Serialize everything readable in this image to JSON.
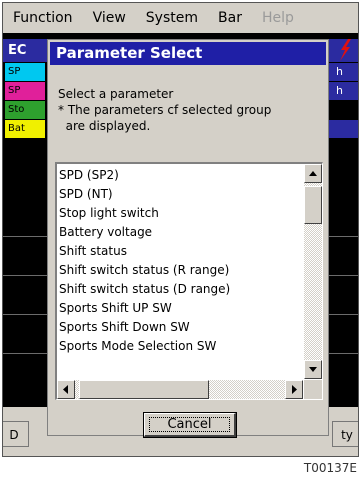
{
  "menu": [
    "Function",
    "View",
    "System",
    "Bar",
    "Help"
  ],
  "background": {
    "header_text": "EC",
    "side_rows": [
      "SP",
      "SP",
      "Sto",
      "Bat"
    ],
    "right_rows": [
      "h",
      "h"
    ],
    "bottom_left": "D",
    "bottom_right": "ty"
  },
  "dialog": {
    "title": "Parameter Select",
    "message_line1": "Select a parameter",
    "message_line2": "* The parameters cf selected group",
    "message_line3": "  are displayed.",
    "items": [
      "SPD (SP2)",
      "SPD (NT)",
      "Stop light switch",
      "Battery voltage",
      "Shift status",
      "Shift switch status (R range)",
      "Shift switch status (D range)",
      "Sports Shift UP SW",
      "Sports Shift Down SW",
      "Sports Mode Selection SW"
    ],
    "cancel_label": "Cancel"
  },
  "figure_code": "T00137E",
  "colors": {
    "title_bar": "#1f1fa6",
    "row_cyan": "#00c8f0",
    "row_magenta": "#e0209a",
    "row_green": "#2ea02e",
    "row_yellow": "#f0f000"
  }
}
